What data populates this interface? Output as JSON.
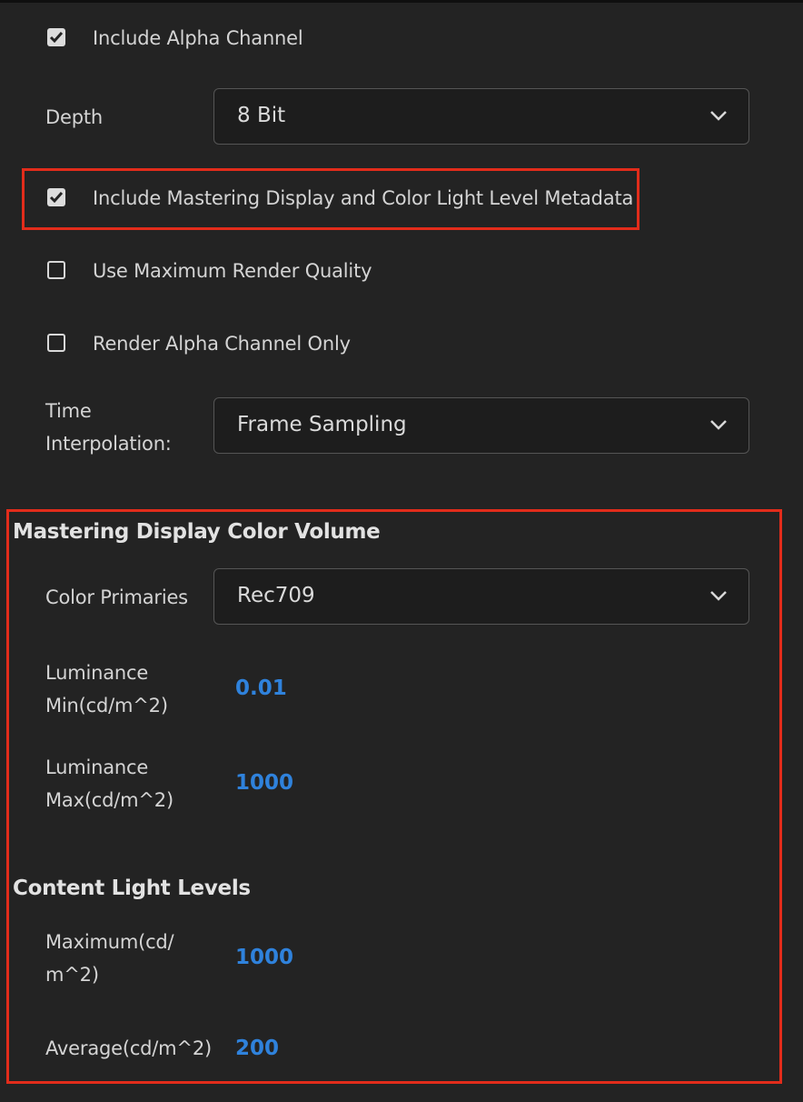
{
  "options": {
    "include_alpha": {
      "label": "Include Alpha Channel",
      "checked": true
    },
    "include_mastering": {
      "label": "Include Mastering Display and Color Light Level Metadata",
      "checked": true
    },
    "max_render_quality": {
      "label": "Use Maximum Render Quality",
      "checked": false
    },
    "render_alpha_only": {
      "label": "Render Alpha Channel Only",
      "checked": false
    }
  },
  "depth": {
    "label": "Depth",
    "value": "8 Bit"
  },
  "time_interpolation": {
    "label_line1": "Time",
    "label_line2": "Interpolation:",
    "value": "Frame Sampling"
  },
  "mastering": {
    "title": "Mastering Display Color Volume",
    "color_primaries": {
      "label": "Color Primaries",
      "value": "Rec709"
    },
    "lum_min": {
      "label_line1": "Luminance",
      "label_line2": "Min(cd/m^2)",
      "value": "0.01"
    },
    "lum_max": {
      "label_line1": "Luminance",
      "label_line2": "Max(cd/m^2)",
      "value": "1000"
    }
  },
  "content_light": {
    "title": "Content Light Levels",
    "maximum": {
      "label_line1": "Maximum(cd/",
      "label_line2": "m^2)",
      "value": "1000"
    },
    "average": {
      "label": "Average(cd/m^2)",
      "value": "200"
    }
  },
  "colors": {
    "background": "#232323",
    "highlight": "#e22c1b",
    "value_blue": "#2f82dc",
    "checkbox": "#dcdcdc"
  },
  "icons": {
    "checkmark": "checkmark-icon",
    "dropdown": "chevron-down-icon"
  }
}
